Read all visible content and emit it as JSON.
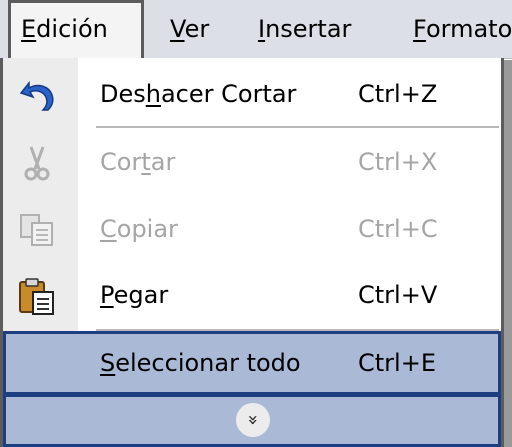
{
  "menubar": {
    "items": [
      {
        "pre": "",
        "acc": "E",
        "post": "dición"
      },
      {
        "pre": "",
        "acc": "V",
        "post": "er"
      },
      {
        "pre": "",
        "acc": "I",
        "post": "nsertar"
      },
      {
        "pre": "",
        "acc": "F",
        "post": "ormato"
      }
    ]
  },
  "menu": {
    "items": [
      {
        "pre": "Des",
        "acc": "h",
        "post": "acer Cortar",
        "shortcut": "Ctrl+Z",
        "icon": "undo-icon",
        "enabled": true
      },
      {
        "pre": "Cor",
        "acc": "t",
        "post": "ar",
        "shortcut": "Ctrl+X",
        "icon": "scissors-icon",
        "enabled": false
      },
      {
        "pre": "",
        "acc": "C",
        "post": "opiar",
        "shortcut": "Ctrl+C",
        "icon": "copy-icon",
        "enabled": false
      },
      {
        "pre": "",
        "acc": "P",
        "post": "egar",
        "shortcut": "Ctrl+V",
        "icon": "paste-icon",
        "enabled": true
      },
      {
        "pre": "",
        "acc": "S",
        "post": "eleccionar todo",
        "shortcut": "Ctrl+E",
        "icon": "",
        "enabled": true
      }
    ],
    "expand_glyph": "»",
    "colors": {
      "highlight": "#a9b9d6",
      "highlight_border": "#1e3f7f",
      "disabled_text": "#a5a5a5",
      "undo_blue": "#2a63c8"
    }
  }
}
